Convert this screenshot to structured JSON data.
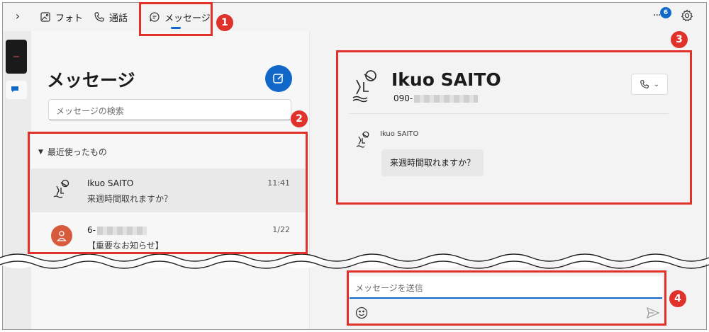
{
  "nav": {
    "tabs": [
      {
        "label": "フォト",
        "icon": "photo-icon"
      },
      {
        "label": "通話",
        "icon": "phone-icon"
      },
      {
        "label": "メッセージ",
        "icon": "chat-bubble-icon",
        "selected": true
      }
    ],
    "notification_count": "6"
  },
  "messages_panel": {
    "title": "メッセージ",
    "search_placeholder": "メッセージの検索",
    "section_label": "最近使ったもの",
    "conversations": [
      {
        "name": "Ikuo SAITO",
        "time": "11:41",
        "preview": "来週時間取れますか？",
        "selected": true
      },
      {
        "name": "6-",
        "time": "1/22",
        "preview": "【重要なお知らせ】"
      }
    ]
  },
  "conversation": {
    "contact_name": "Ikuo SAITO",
    "phone_prefix": "090-",
    "message": {
      "sender": "Ikuo SAITO",
      "text": "来週時間取れますか？"
    },
    "compose_placeholder": "メッセージを送信"
  },
  "annotations": [
    "1",
    "2",
    "3",
    "4"
  ],
  "colors": {
    "accent": "#1168c8",
    "annotation": "#e0312b",
    "avatar_red": "#d65a3b"
  }
}
